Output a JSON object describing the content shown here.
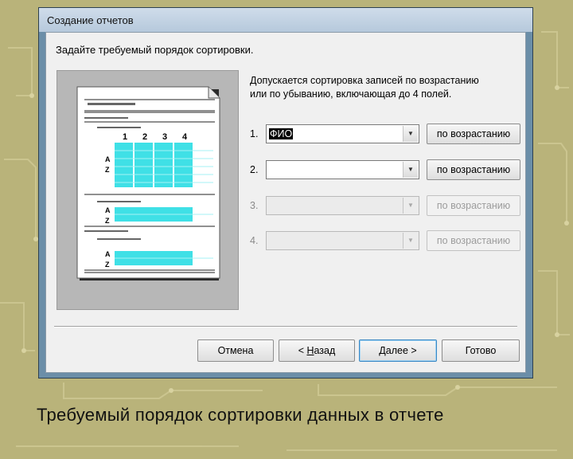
{
  "window": {
    "title": "Создание отчетов"
  },
  "header": {
    "prompt": "Задайте требуемый порядок сортировки."
  },
  "description": {
    "line1": "Допускается сортировка записей по возрастанию",
    "line2": "или по убыванию, включающая до 4 полей."
  },
  "preview": {
    "column_numbers": [
      "1",
      "2",
      "3",
      "4"
    ],
    "sort_glyph_top": "A",
    "sort_glyph_bottom": "Z"
  },
  "sort_rows": [
    {
      "number": "1.",
      "value": "ФИО",
      "order_label": "по возрастанию",
      "enabled": true
    },
    {
      "number": "2.",
      "value": "",
      "order_label": "по возрастанию",
      "enabled": true
    },
    {
      "number": "3.",
      "value": "",
      "order_label": "по возрастанию",
      "enabled": false
    },
    {
      "number": "4.",
      "value": "",
      "order_label": "по возрастанию",
      "enabled": false
    }
  ],
  "footer": {
    "cancel": "Отмена",
    "back_prefix": "< ",
    "back_accel": "Н",
    "back_rest": "азад",
    "next_accel": "Д",
    "next_rest": "алее >",
    "finish": "Готово"
  },
  "caption": "Требуемый порядок сортировки данных в отчете",
  "colors": {
    "background": "#b9b37a",
    "preview_highlight": "#3fe0e6",
    "window_frame": "#6b8ea8"
  }
}
